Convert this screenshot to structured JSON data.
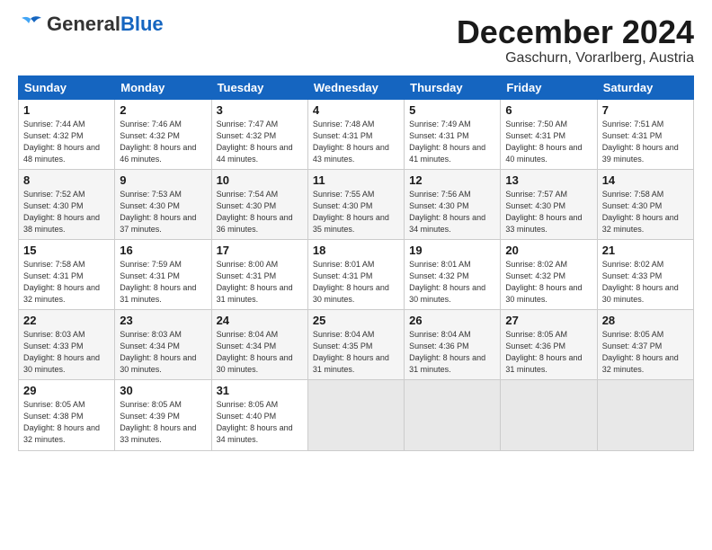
{
  "header": {
    "logo_general": "General",
    "logo_blue": "Blue",
    "month_title": "December 2024",
    "location": "Gaschurn, Vorarlberg, Austria"
  },
  "weekdays": [
    "Sunday",
    "Monday",
    "Tuesday",
    "Wednesday",
    "Thursday",
    "Friday",
    "Saturday"
  ],
  "weeks": [
    [
      {
        "day": "1",
        "sunrise": "Sunrise: 7:44 AM",
        "sunset": "Sunset: 4:32 PM",
        "daylight": "Daylight: 8 hours and 48 minutes."
      },
      {
        "day": "2",
        "sunrise": "Sunrise: 7:46 AM",
        "sunset": "Sunset: 4:32 PM",
        "daylight": "Daylight: 8 hours and 46 minutes."
      },
      {
        "day": "3",
        "sunrise": "Sunrise: 7:47 AM",
        "sunset": "Sunset: 4:32 PM",
        "daylight": "Daylight: 8 hours and 44 minutes."
      },
      {
        "day": "4",
        "sunrise": "Sunrise: 7:48 AM",
        "sunset": "Sunset: 4:31 PM",
        "daylight": "Daylight: 8 hours and 43 minutes."
      },
      {
        "day": "5",
        "sunrise": "Sunrise: 7:49 AM",
        "sunset": "Sunset: 4:31 PM",
        "daylight": "Daylight: 8 hours and 41 minutes."
      },
      {
        "day": "6",
        "sunrise": "Sunrise: 7:50 AM",
        "sunset": "Sunset: 4:31 PM",
        "daylight": "Daylight: 8 hours and 40 minutes."
      },
      {
        "day": "7",
        "sunrise": "Sunrise: 7:51 AM",
        "sunset": "Sunset: 4:31 PM",
        "daylight": "Daylight: 8 hours and 39 minutes."
      }
    ],
    [
      {
        "day": "8",
        "sunrise": "Sunrise: 7:52 AM",
        "sunset": "Sunset: 4:30 PM",
        "daylight": "Daylight: 8 hours and 38 minutes."
      },
      {
        "day": "9",
        "sunrise": "Sunrise: 7:53 AM",
        "sunset": "Sunset: 4:30 PM",
        "daylight": "Daylight: 8 hours and 37 minutes."
      },
      {
        "day": "10",
        "sunrise": "Sunrise: 7:54 AM",
        "sunset": "Sunset: 4:30 PM",
        "daylight": "Daylight: 8 hours and 36 minutes."
      },
      {
        "day": "11",
        "sunrise": "Sunrise: 7:55 AM",
        "sunset": "Sunset: 4:30 PM",
        "daylight": "Daylight: 8 hours and 35 minutes."
      },
      {
        "day": "12",
        "sunrise": "Sunrise: 7:56 AM",
        "sunset": "Sunset: 4:30 PM",
        "daylight": "Daylight: 8 hours and 34 minutes."
      },
      {
        "day": "13",
        "sunrise": "Sunrise: 7:57 AM",
        "sunset": "Sunset: 4:30 PM",
        "daylight": "Daylight: 8 hours and 33 minutes."
      },
      {
        "day": "14",
        "sunrise": "Sunrise: 7:58 AM",
        "sunset": "Sunset: 4:30 PM",
        "daylight": "Daylight: 8 hours and 32 minutes."
      }
    ],
    [
      {
        "day": "15",
        "sunrise": "Sunrise: 7:58 AM",
        "sunset": "Sunset: 4:31 PM",
        "daylight": "Daylight: 8 hours and 32 minutes."
      },
      {
        "day": "16",
        "sunrise": "Sunrise: 7:59 AM",
        "sunset": "Sunset: 4:31 PM",
        "daylight": "Daylight: 8 hours and 31 minutes."
      },
      {
        "day": "17",
        "sunrise": "Sunrise: 8:00 AM",
        "sunset": "Sunset: 4:31 PM",
        "daylight": "Daylight: 8 hours and 31 minutes."
      },
      {
        "day": "18",
        "sunrise": "Sunrise: 8:01 AM",
        "sunset": "Sunset: 4:31 PM",
        "daylight": "Daylight: 8 hours and 30 minutes."
      },
      {
        "day": "19",
        "sunrise": "Sunrise: 8:01 AM",
        "sunset": "Sunset: 4:32 PM",
        "daylight": "Daylight: 8 hours and 30 minutes."
      },
      {
        "day": "20",
        "sunrise": "Sunrise: 8:02 AM",
        "sunset": "Sunset: 4:32 PM",
        "daylight": "Daylight: 8 hours and 30 minutes."
      },
      {
        "day": "21",
        "sunrise": "Sunrise: 8:02 AM",
        "sunset": "Sunset: 4:33 PM",
        "daylight": "Daylight: 8 hours and 30 minutes."
      }
    ],
    [
      {
        "day": "22",
        "sunrise": "Sunrise: 8:03 AM",
        "sunset": "Sunset: 4:33 PM",
        "daylight": "Daylight: 8 hours and 30 minutes."
      },
      {
        "day": "23",
        "sunrise": "Sunrise: 8:03 AM",
        "sunset": "Sunset: 4:34 PM",
        "daylight": "Daylight: 8 hours and 30 minutes."
      },
      {
        "day": "24",
        "sunrise": "Sunrise: 8:04 AM",
        "sunset": "Sunset: 4:34 PM",
        "daylight": "Daylight: 8 hours and 30 minutes."
      },
      {
        "day": "25",
        "sunrise": "Sunrise: 8:04 AM",
        "sunset": "Sunset: 4:35 PM",
        "daylight": "Daylight: 8 hours and 31 minutes."
      },
      {
        "day": "26",
        "sunrise": "Sunrise: 8:04 AM",
        "sunset": "Sunset: 4:36 PM",
        "daylight": "Daylight: 8 hours and 31 minutes."
      },
      {
        "day": "27",
        "sunrise": "Sunrise: 8:05 AM",
        "sunset": "Sunset: 4:36 PM",
        "daylight": "Daylight: 8 hours and 31 minutes."
      },
      {
        "day": "28",
        "sunrise": "Sunrise: 8:05 AM",
        "sunset": "Sunset: 4:37 PM",
        "daylight": "Daylight: 8 hours and 32 minutes."
      }
    ],
    [
      {
        "day": "29",
        "sunrise": "Sunrise: 8:05 AM",
        "sunset": "Sunset: 4:38 PM",
        "daylight": "Daylight: 8 hours and 32 minutes."
      },
      {
        "day": "30",
        "sunrise": "Sunrise: 8:05 AM",
        "sunset": "Sunset: 4:39 PM",
        "daylight": "Daylight: 8 hours and 33 minutes."
      },
      {
        "day": "31",
        "sunrise": "Sunrise: 8:05 AM",
        "sunset": "Sunset: 4:40 PM",
        "daylight": "Daylight: 8 hours and 34 minutes."
      },
      null,
      null,
      null,
      null
    ]
  ]
}
